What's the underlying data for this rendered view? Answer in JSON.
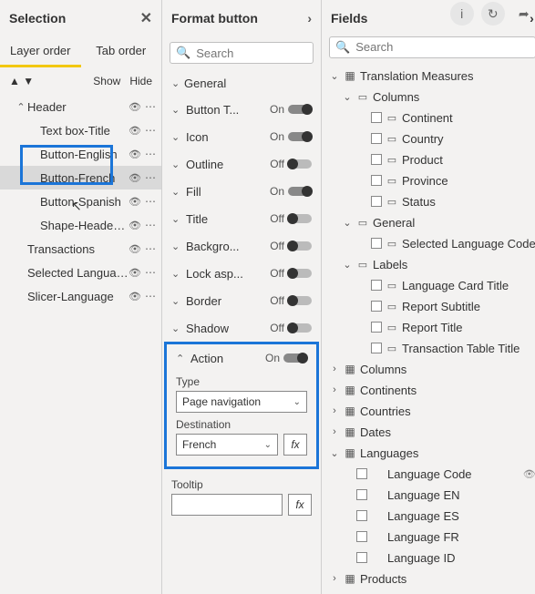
{
  "selection": {
    "title": "Selection",
    "tabs": {
      "layer": "Layer order",
      "tab": "Tab order"
    },
    "show": "Show",
    "hide": "Hide",
    "items": [
      {
        "label": "Header",
        "type": "group"
      },
      {
        "label": "Text box-Title",
        "type": "item"
      },
      {
        "label": "Button-English",
        "type": "item"
      },
      {
        "label": "Button-French",
        "type": "item",
        "selected": true
      },
      {
        "label": "Button-Spanish",
        "type": "item"
      },
      {
        "label": "Shape-Header Ba...",
        "type": "item"
      },
      {
        "label": "Transactions",
        "type": "top"
      },
      {
        "label": "Selected Language C...",
        "type": "top"
      },
      {
        "label": "Slicer-Language",
        "type": "top"
      }
    ]
  },
  "format": {
    "title": "Format button",
    "search_placeholder": "Search",
    "general": "General",
    "props": [
      {
        "label": "Button T...",
        "state": "on",
        "txt": "On"
      },
      {
        "label": "Icon",
        "state": "on",
        "txt": "On"
      },
      {
        "label": "Outline",
        "state": "off",
        "txt": "Off"
      },
      {
        "label": "Fill",
        "state": "on",
        "txt": "On"
      },
      {
        "label": "Title",
        "state": "off",
        "txt": "Off"
      },
      {
        "label": "Backgro...",
        "state": "off",
        "txt": "Off"
      },
      {
        "label": "Lock asp...",
        "state": "off",
        "txt": "Off"
      },
      {
        "label": "Border",
        "state": "off",
        "txt": "Off"
      },
      {
        "label": "Shadow",
        "state": "off",
        "txt": "Off"
      }
    ],
    "action": {
      "label": "Action",
      "state": "on",
      "txt": "On",
      "type_label": "Type",
      "type_value": "Page navigation",
      "dest_label": "Destination",
      "dest_value": "French",
      "tooltip_label": "Tooltip",
      "tooltip_value": "",
      "fx": "fx"
    }
  },
  "fields": {
    "title": "Fields",
    "search_placeholder": "Search",
    "tree": [
      {
        "ind": 0,
        "caret": "v",
        "icon": "tbl",
        "label": "Translation Measures"
      },
      {
        "ind": 1,
        "caret": "v",
        "icon": "folder",
        "label": "Columns"
      },
      {
        "ind": 2,
        "chk": true,
        "icon": "fld",
        "label": "Continent"
      },
      {
        "ind": 2,
        "chk": true,
        "icon": "fld",
        "label": "Country"
      },
      {
        "ind": 2,
        "chk": true,
        "icon": "fld",
        "label": "Product"
      },
      {
        "ind": 2,
        "chk": true,
        "icon": "fld",
        "label": "Province"
      },
      {
        "ind": 2,
        "chk": true,
        "icon": "fld",
        "label": "Status"
      },
      {
        "ind": 1,
        "caret": "v",
        "icon": "folder",
        "label": "General"
      },
      {
        "ind": 2,
        "chk": true,
        "icon": "fld",
        "label": "Selected Language Code"
      },
      {
        "ind": 1,
        "caret": "v",
        "icon": "folder",
        "label": "Labels"
      },
      {
        "ind": 2,
        "chk": true,
        "icon": "fld",
        "label": "Language Card Title"
      },
      {
        "ind": 2,
        "chk": true,
        "icon": "fld",
        "label": "Report Subtitle"
      },
      {
        "ind": 2,
        "chk": true,
        "icon": "fld",
        "label": "Report Title"
      },
      {
        "ind": 2,
        "chk": true,
        "icon": "fld",
        "label": "Transaction Table Title"
      },
      {
        "ind": 0,
        "caret": ">",
        "icon": "tbl",
        "label": "Columns"
      },
      {
        "ind": 0,
        "caret": ">",
        "icon": "tbl",
        "label": "Continents"
      },
      {
        "ind": 0,
        "caret": ">",
        "icon": "tbl",
        "label": "Countries"
      },
      {
        "ind": 0,
        "caret": ">",
        "icon": "tbl",
        "label": "Dates"
      },
      {
        "ind": 0,
        "caret": "v",
        "icon": "tbl",
        "label": "Languages"
      },
      {
        "ind": 1,
        "chk": true,
        "label": "Language Code",
        "hidden": true
      },
      {
        "ind": 1,
        "chk": true,
        "label": "Language EN"
      },
      {
        "ind": 1,
        "chk": true,
        "label": "Language ES"
      },
      {
        "ind": 1,
        "chk": true,
        "label": "Language FR"
      },
      {
        "ind": 1,
        "chk": true,
        "label": "Language ID"
      },
      {
        "ind": 0,
        "caret": ">",
        "icon": "tbl",
        "label": "Products"
      }
    ]
  }
}
